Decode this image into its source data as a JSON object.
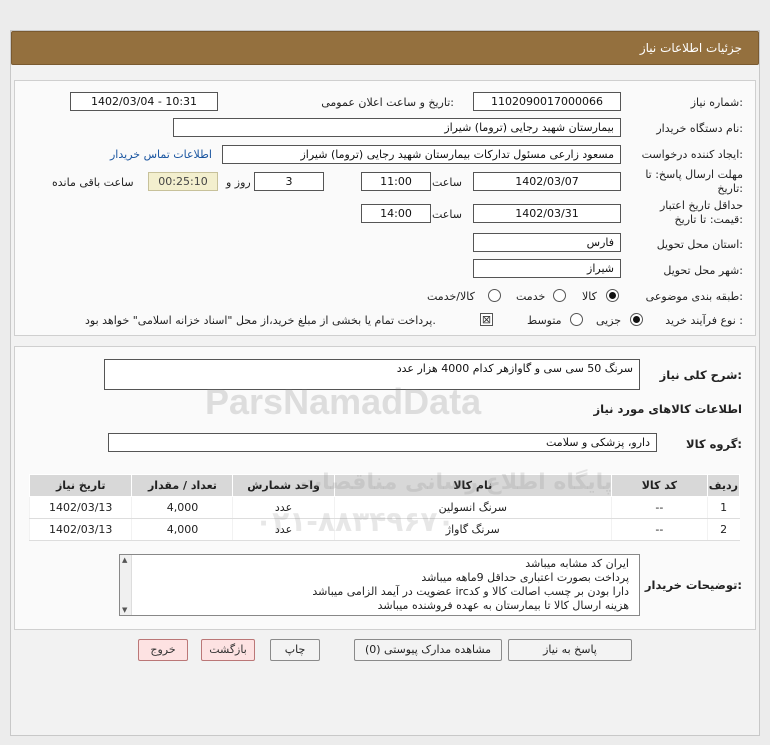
{
  "header": {
    "title": "جزئیات اطلاعات نیاز"
  },
  "form": {
    "need_number_label": "شماره نیاز:",
    "need_number": "1102090017000066",
    "announce_label": "تاریخ و ساعت اعلان عمومی:",
    "announce_value": "1402/03/04 - 10:31",
    "buyer_label": "نام دستگاه خریدار:",
    "buyer_value": "بیمارستان شهید رجایی (تروما) شیراز",
    "creator_label": "ایجاد کننده درخواست:",
    "creator_value": "مسعود زارعی مسئول تدارکات بیمارستان شهید رجایی (تروما) شیراز",
    "contact_link": "اطلاعات تماس خریدار",
    "reply_deadline_label_1": "مهلت ارسال پاسخ: تا",
    "reply_deadline_label_2": "تاریخ:",
    "reply_date": "1402/03/07",
    "time_label": "ساعت",
    "reply_time": "11:00",
    "days_value": "3",
    "days_label": "روز و",
    "remaining_time": "00:25:10",
    "remaining_label": "ساعت باقی مانده",
    "validity_label_1": "حداقل تاریخ اعتبار",
    "validity_label_2": "قیمت: تا تاریخ:",
    "validity_date": "1402/03/31",
    "validity_time": "14:00",
    "province_label": "استان محل تحویل:",
    "province_value": "فارس",
    "city_label": "شهر محل تحویل:",
    "city_value": "شیراز",
    "category_label": "طبقه بندی موضوعی:",
    "category_options": [
      "کالا",
      "خدمت",
      "کالا/خدمت"
    ],
    "category_selected": "کالا",
    "process_label": "نوع فرآیند خرید :",
    "process_options": [
      "جزیی",
      "متوسط"
    ],
    "process_selected": "جزیی",
    "payment_note": "پرداخت تمام یا بخشی از مبلغ خرید،از محل \"اسناد خزانه اسلامی\" خواهد بود."
  },
  "summary": {
    "label": "شرح کلی نیاز:",
    "value": "سرنگ 50 سی سی و گاوازهر کدام 4000 هزار عدد"
  },
  "goods": {
    "section_title": "اطلاعات کالاهای مورد نیاز",
    "group_label": "گروه کالا:",
    "group_value": "دارو، پزشکی و سلامت",
    "columns": [
      "ردیف",
      "کد کالا",
      "نام کالا",
      "واحد شمارش",
      "تعداد / مقدار",
      "تاریخ نیاز"
    ],
    "rows": [
      [
        "1",
        "--",
        "سرنگ انسولین",
        "عدد",
        "4,000",
        "1402/03/13"
      ],
      [
        "2",
        "--",
        "سرنگ گاواژ",
        "عدد",
        "4,000",
        "1402/03/13"
      ]
    ]
  },
  "buyer_notes": {
    "label": "توضیحات خریدار:",
    "lines": [
      "ایران کد مشابه میباشد",
      "پرداخت بصورت اعتباری حداقل 9ماهه میباشد",
      "دارا بودن بر چسب اصالت کالا و کدirc عضویت در آیمد الزامی میباشد",
      "هزینه ارسال کالا تا بیمارستان به عهده فروشنده میباشد"
    ]
  },
  "buttons": {
    "reply": "پاسخ به نیاز",
    "view_docs": "مشاهده مدارک پیوستی (0)",
    "print": "چاپ",
    "back": "بازگشت",
    "exit": "خروج"
  },
  "watermark": {
    "brand": "ParsNamadData",
    "line1": "پایگاه اطلاع رسانی مناقصات",
    "phone": "۰۲۱-۸۸۳۴۹۶۷۰"
  },
  "colors": {
    "title_bar": "#94703e",
    "link": "#1a55a0",
    "timer_bg": "#f3efce"
  }
}
